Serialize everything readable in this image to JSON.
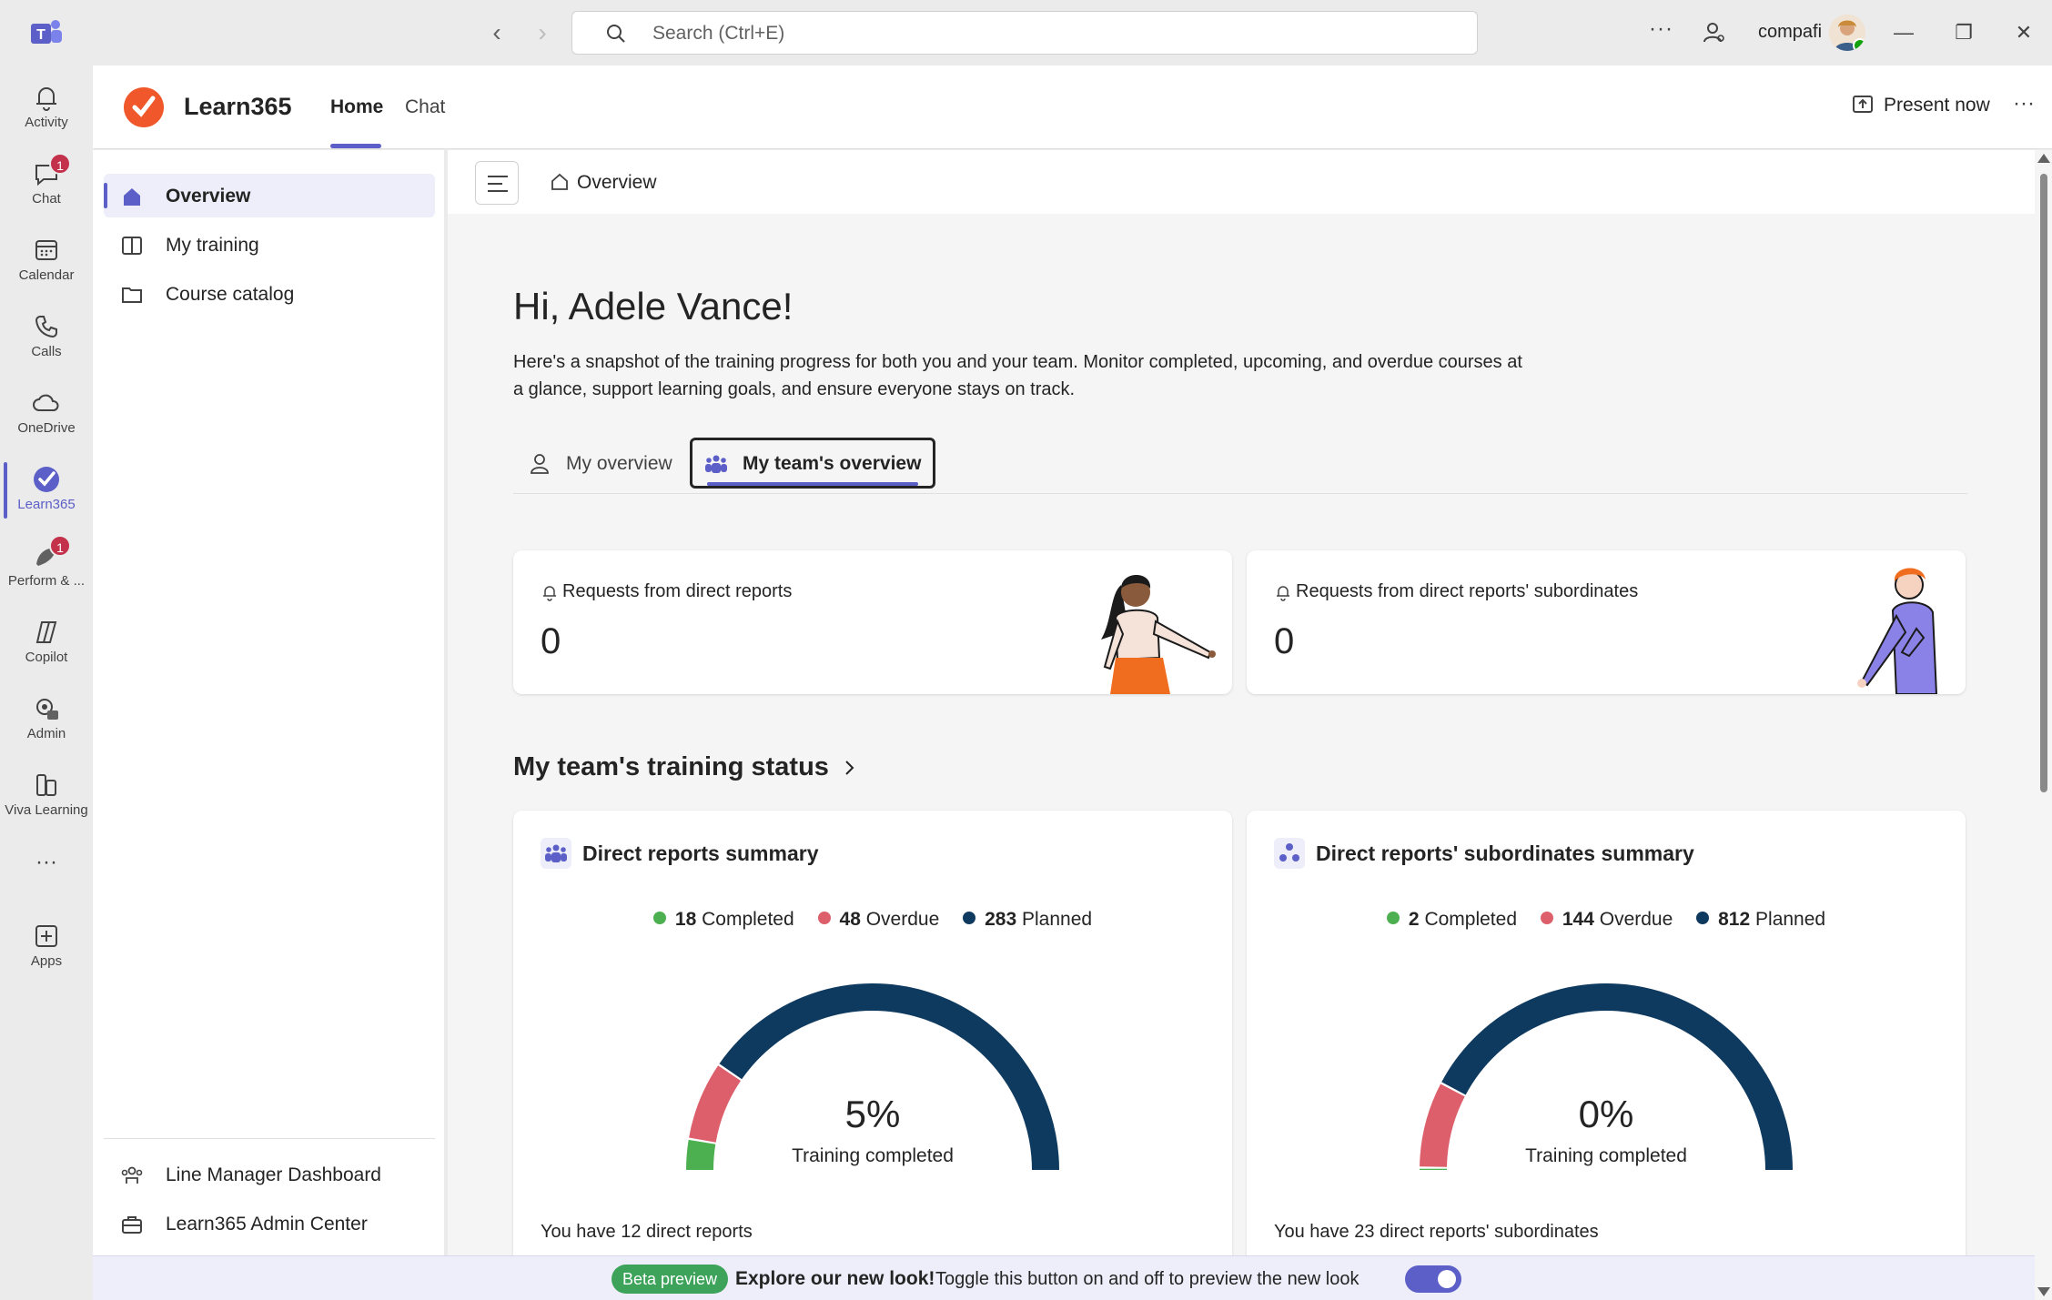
{
  "titlebar": {
    "search_placeholder": "Search (Ctrl+E)",
    "user_name": "compafi",
    "more_label": "···"
  },
  "rail": {
    "items": [
      {
        "label": "Activity",
        "icon": "bell-icon"
      },
      {
        "label": "Chat",
        "icon": "chat-icon",
        "badge": "1"
      },
      {
        "label": "Calendar",
        "icon": "calendar-icon"
      },
      {
        "label": "Calls",
        "icon": "phone-icon"
      },
      {
        "label": "OneDrive",
        "icon": "cloud-icon"
      },
      {
        "label": "Learn365",
        "icon": "learn365-icon",
        "active": true
      },
      {
        "label": "Perform & ...",
        "icon": "perform-icon",
        "badge": "1"
      },
      {
        "label": "Copilot",
        "icon": "copilot-icon"
      },
      {
        "label": "Admin",
        "icon": "admin-icon"
      },
      {
        "label": "Viva Learning",
        "icon": "viva-learning-icon"
      },
      {
        "label": "Apps",
        "icon": "apps-icon"
      }
    ],
    "more_label": "···"
  },
  "app": {
    "name": "Learn365",
    "tabs": [
      "Home",
      "Chat"
    ],
    "active_tab": "Home",
    "present_label": "Present now",
    "more_label": "···"
  },
  "sidebar": {
    "items": [
      "Overview",
      "My training",
      "Course catalog"
    ],
    "bottom_items": [
      "Line Manager Dashboard",
      "Learn365 Admin Center"
    ]
  },
  "breadcrumb": "Overview",
  "greeting": "Hi, Adele Vance!",
  "intro": "Here's a snapshot of the training progress for both you and your team. Monitor completed, upcoming, and overdue courses at a glance, support learning goals, and ensure everyone stays on track.",
  "tabs": [
    "My overview",
    "My team's overview"
  ],
  "requests": [
    {
      "title": "Requests from direct reports",
      "count": "0"
    },
    {
      "title": "Requests from direct reports' subordinates",
      "count": "0"
    }
  ],
  "section_title": "My team's training status",
  "summaries": [
    {
      "title": "Direct reports summary",
      "completed": 18,
      "overdue": 48,
      "planned": 283,
      "completed_label": "Completed",
      "overdue_label": "Overdue",
      "planned_label": "Planned",
      "percent": "5%",
      "gauge_label": "Training completed",
      "footer": "You have 12 direct reports"
    },
    {
      "title": "Direct reports' subordinates summary",
      "completed": 2,
      "overdue": 144,
      "planned": 812,
      "completed_label": "Completed",
      "overdue_label": "Overdue",
      "planned_label": "Planned",
      "percent": "0%",
      "gauge_label": "Training completed",
      "footer": "You have 23 direct reports' subordinates"
    }
  ],
  "beta": {
    "badge": "Beta preview",
    "title": "Explore our new look!",
    "description": "Toggle this button on and off to preview the new look",
    "toggle_on": true
  },
  "colors": {
    "accent": "#5b5fc7",
    "completed": "#4caf50",
    "overdue": "#dc5f6b",
    "planned": "#0f3a5f",
    "brand": "#f0582b"
  }
}
